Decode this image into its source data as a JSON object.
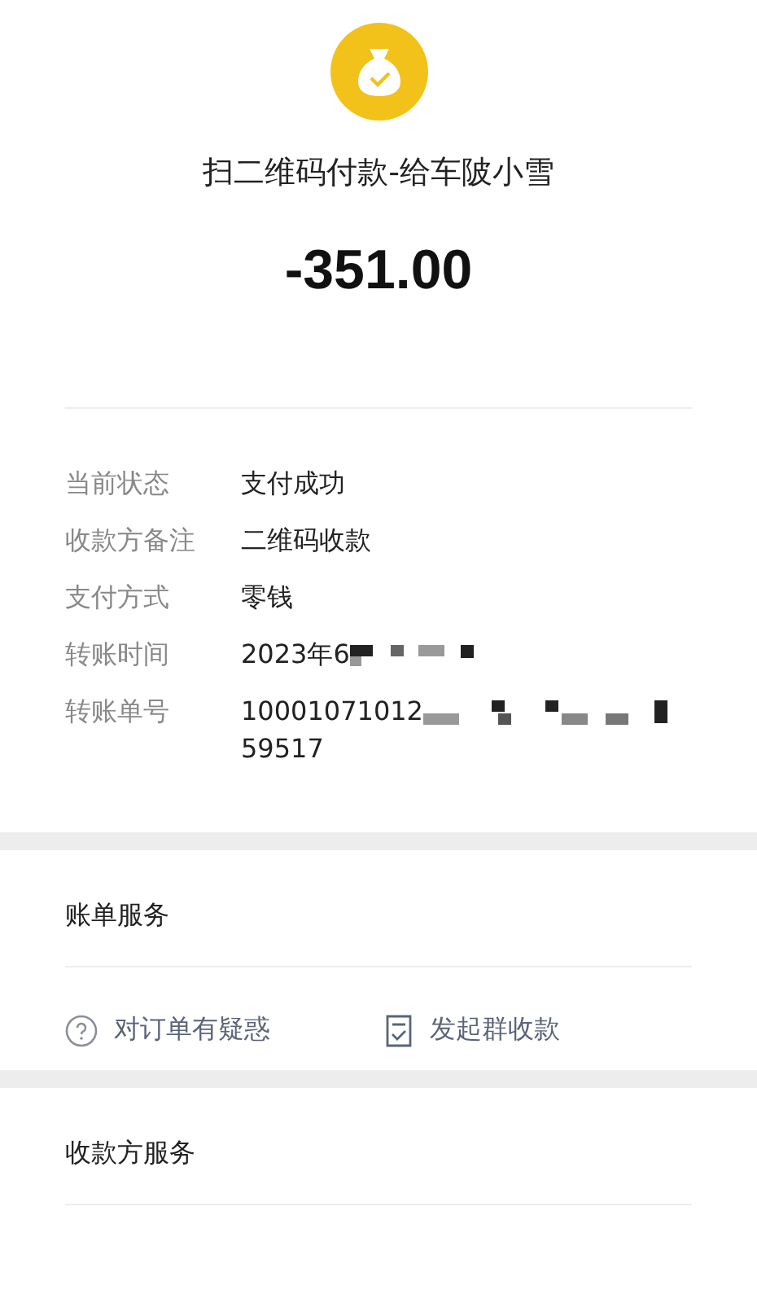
{
  "payee_title": "扫二维码付款-给车陂小雪",
  "amount": "-351.00",
  "details": [
    {
      "label": "当前状态",
      "value": "支付成功",
      "redacted": false
    },
    {
      "label": "收款方备注",
      "value": "二维码收款",
      "redacted": false
    },
    {
      "label": "支付方式",
      "value": "零钱",
      "redacted": false
    },
    {
      "label": "转账时间",
      "value": "2023年6",
      "redacted": true
    },
    {
      "label": "转账单号",
      "value": "10001071012",
      "redacted": true,
      "continuation": "59517"
    }
  ],
  "bill_services": {
    "title": "账单服务",
    "actions": [
      {
        "kind": "question",
        "label": "对订单有疑惑"
      },
      {
        "kind": "bill",
        "label": "发起群收款"
      }
    ]
  },
  "payee_services": {
    "title": "收款方服务"
  }
}
